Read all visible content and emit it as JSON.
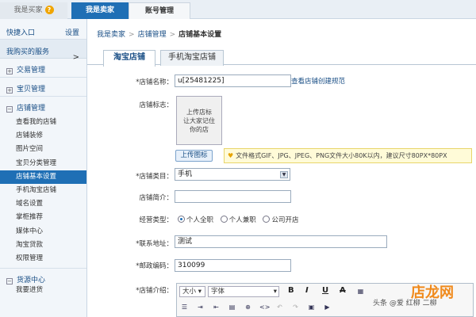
{
  "top_tabs": {
    "buyer": "我是买家",
    "seller": "我是卖家",
    "account": "账号管理"
  },
  "sidebar": {
    "quick_entry": "快捷入口",
    "settings": "设置",
    "bought_services": "我购买的服务",
    "groups": {
      "trade": "交易管理",
      "goods": "宝贝管理",
      "shop": "店铺管理",
      "supply": "货源中心"
    },
    "shop_items": [
      "查看我的店铺",
      "店铺装修",
      "图片空间",
      "宝贝分类管理",
      "店铺基本设置",
      "手机淘宝店铺",
      "域名设置",
      "掌柜推荐",
      "媒体中心",
      "淘宝贷款",
      "权限管理"
    ],
    "supply_items": [
      "我要进货"
    ]
  },
  "breadcrumb": {
    "item1": "我是卖家",
    "item2": "店铺管理",
    "current": "店铺基本设置"
  },
  "tabs": {
    "taobao_shop": "淘宝店铺",
    "mobile_shop": "手机淘宝店铺"
  },
  "form": {
    "shop_name_label": "*店铺名称：",
    "shop_name_value": "u[25481225]",
    "naming_rules_link": "查看店铺创建规范",
    "logo_label": "店铺标志：",
    "logo_box_line1": "上传店标",
    "logo_box_line2": "让大家记住",
    "logo_box_line3": "你的店",
    "upload_button": "上传图标",
    "upload_tip": "文件格式GIF、JPG、JPEG、PNG文件大小80K以内，建议尺寸80PX*80PX",
    "category_label": "*店铺类目：",
    "category_value": "手机",
    "intro_label": "店铺简介：",
    "intro_value": "",
    "business_type_label": "经营类型：",
    "business_types": [
      "个人全职",
      "个人兼职",
      "公司开店"
    ],
    "address_label": "*联系地址：",
    "address_value": "测试",
    "zip_label": "*邮政编码：",
    "zip_value": "310099",
    "description_label": "*店铺介绍：",
    "editor_size": "大小",
    "editor_font": "字体",
    "editor_bold": "B",
    "editor_italic": "I",
    "editor_underline": "U",
    "editor_strike": "A"
  },
  "watermark": {
    "text": "头条 @爱 红柳 二柳",
    "logo": "店龙网"
  },
  "colors": {
    "seller_tab": "#1f6fb5",
    "active_item": "#1f6fb5",
    "link": "#1a4f86",
    "tip_bg": "#fffbd8"
  }
}
